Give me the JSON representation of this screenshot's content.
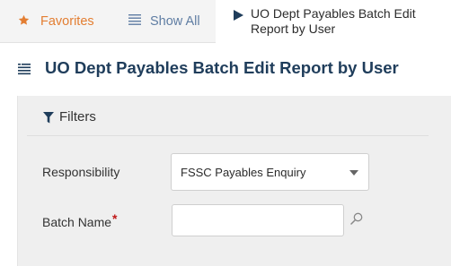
{
  "tabs": {
    "favorites": {
      "label": "Favorites",
      "icon": "star-icon",
      "color": "#e37e32"
    },
    "show_all": {
      "label": "Show All",
      "icon": "list-icon",
      "color": "#5f7da3"
    },
    "active": {
      "label": "UO Dept Payables Batch Edit Report by User",
      "icon": "play-icon"
    }
  },
  "page": {
    "title": "UO Dept Payables Batch Edit Report by User",
    "menu_icon": "hamburger-icon",
    "title_color": "#1f3d5b"
  },
  "filters": {
    "title": "Filters",
    "icon": "filter-icon",
    "responsibility": {
      "label": "Responsibility",
      "value": "FSSC Payables Enquiry",
      "icon": "chevron-down-icon"
    },
    "batch_name": {
      "label": "Batch Name",
      "required_marker": "*",
      "value": "",
      "placeholder": "",
      "lookup_icon": "search-icon"
    }
  }
}
